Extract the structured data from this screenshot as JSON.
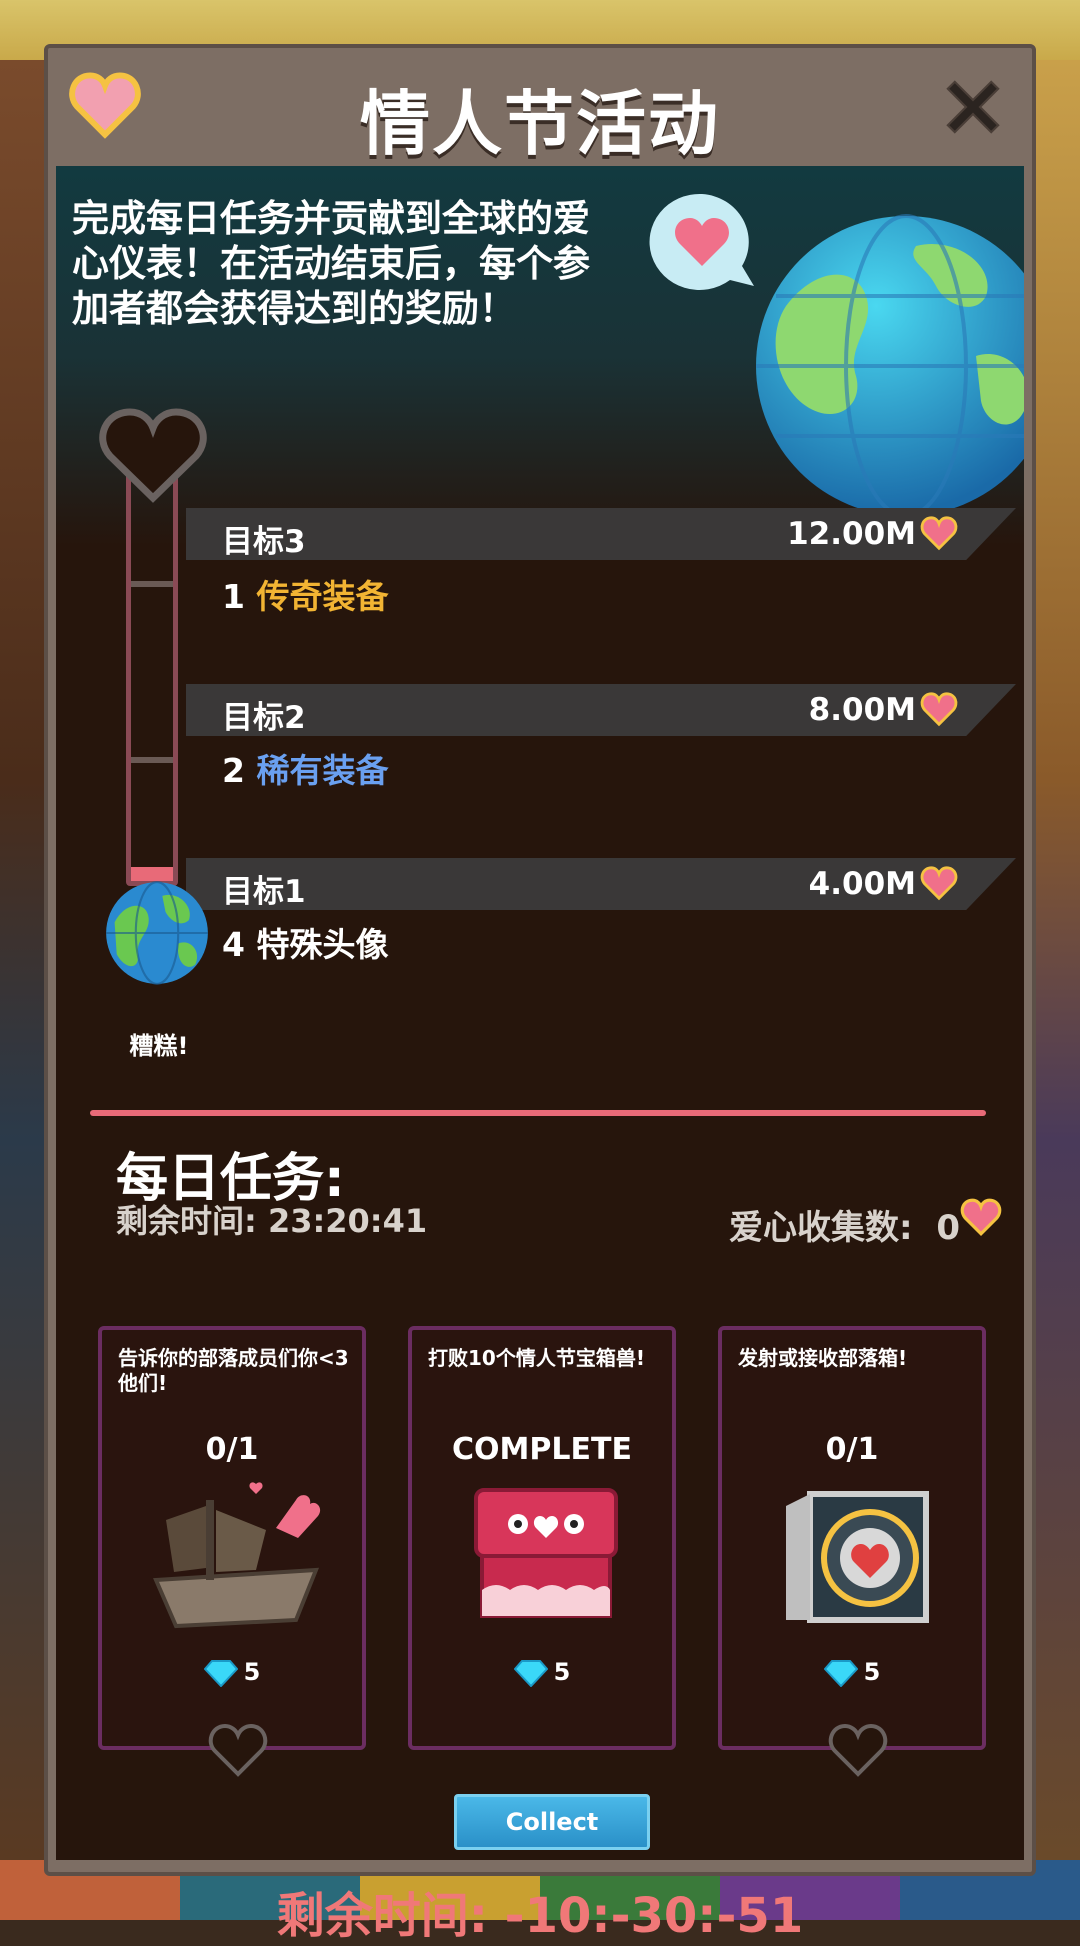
{
  "header": {
    "title": "情人节活动",
    "heart_icon": "heart-icon",
    "close_icon": "close-icon"
  },
  "intro": {
    "text": "完成每日任务并贡献到全球的爱心仪表！在活动结束后，每个参加者都会获得达到的奖励！"
  },
  "goals": [
    {
      "name": "目标3",
      "value": "12.00M",
      "reward_count": "1",
      "reward_name": "传奇装备",
      "reward_color": "#f2b433"
    },
    {
      "name": "目标2",
      "value": "8.00M",
      "reward_count": "2",
      "reward_name": "稀有装备",
      "reward_color": "#6aa0f0"
    },
    {
      "name": "目标1",
      "value": "4.00M",
      "reward_count": "4",
      "reward_name": "特殊头像",
      "reward_color": "#ffffff"
    }
  ],
  "meter": {
    "progress": 0.03,
    "status_label": "糟糕!"
  },
  "daily": {
    "title": "每日任务:",
    "time_left": "剩余时间: 23:20:41",
    "hearts_label": "爱心收集数:",
    "hearts_value": "0"
  },
  "tasks": [
    {
      "description": "告诉你的部落成员们你<3他们!",
      "progress": "0/1",
      "reward": "5",
      "art": "pirate-ship-icon"
    },
    {
      "description": "打败10个情人节宝箱兽!",
      "progress": "COMPLETE",
      "reward": "5",
      "art": "mimic-chest-icon"
    },
    {
      "description": "发射或接收部落箱!",
      "progress": "0/1",
      "reward": "5",
      "art": "clan-crate-icon"
    }
  ],
  "collect_label": "Collect",
  "event_time_left": "剩余时间: -10:-30:-51",
  "colors": {
    "accent": "#e86a78",
    "heart": "#f27a8e",
    "gold": "#f2b433",
    "panel": "#26150c"
  }
}
